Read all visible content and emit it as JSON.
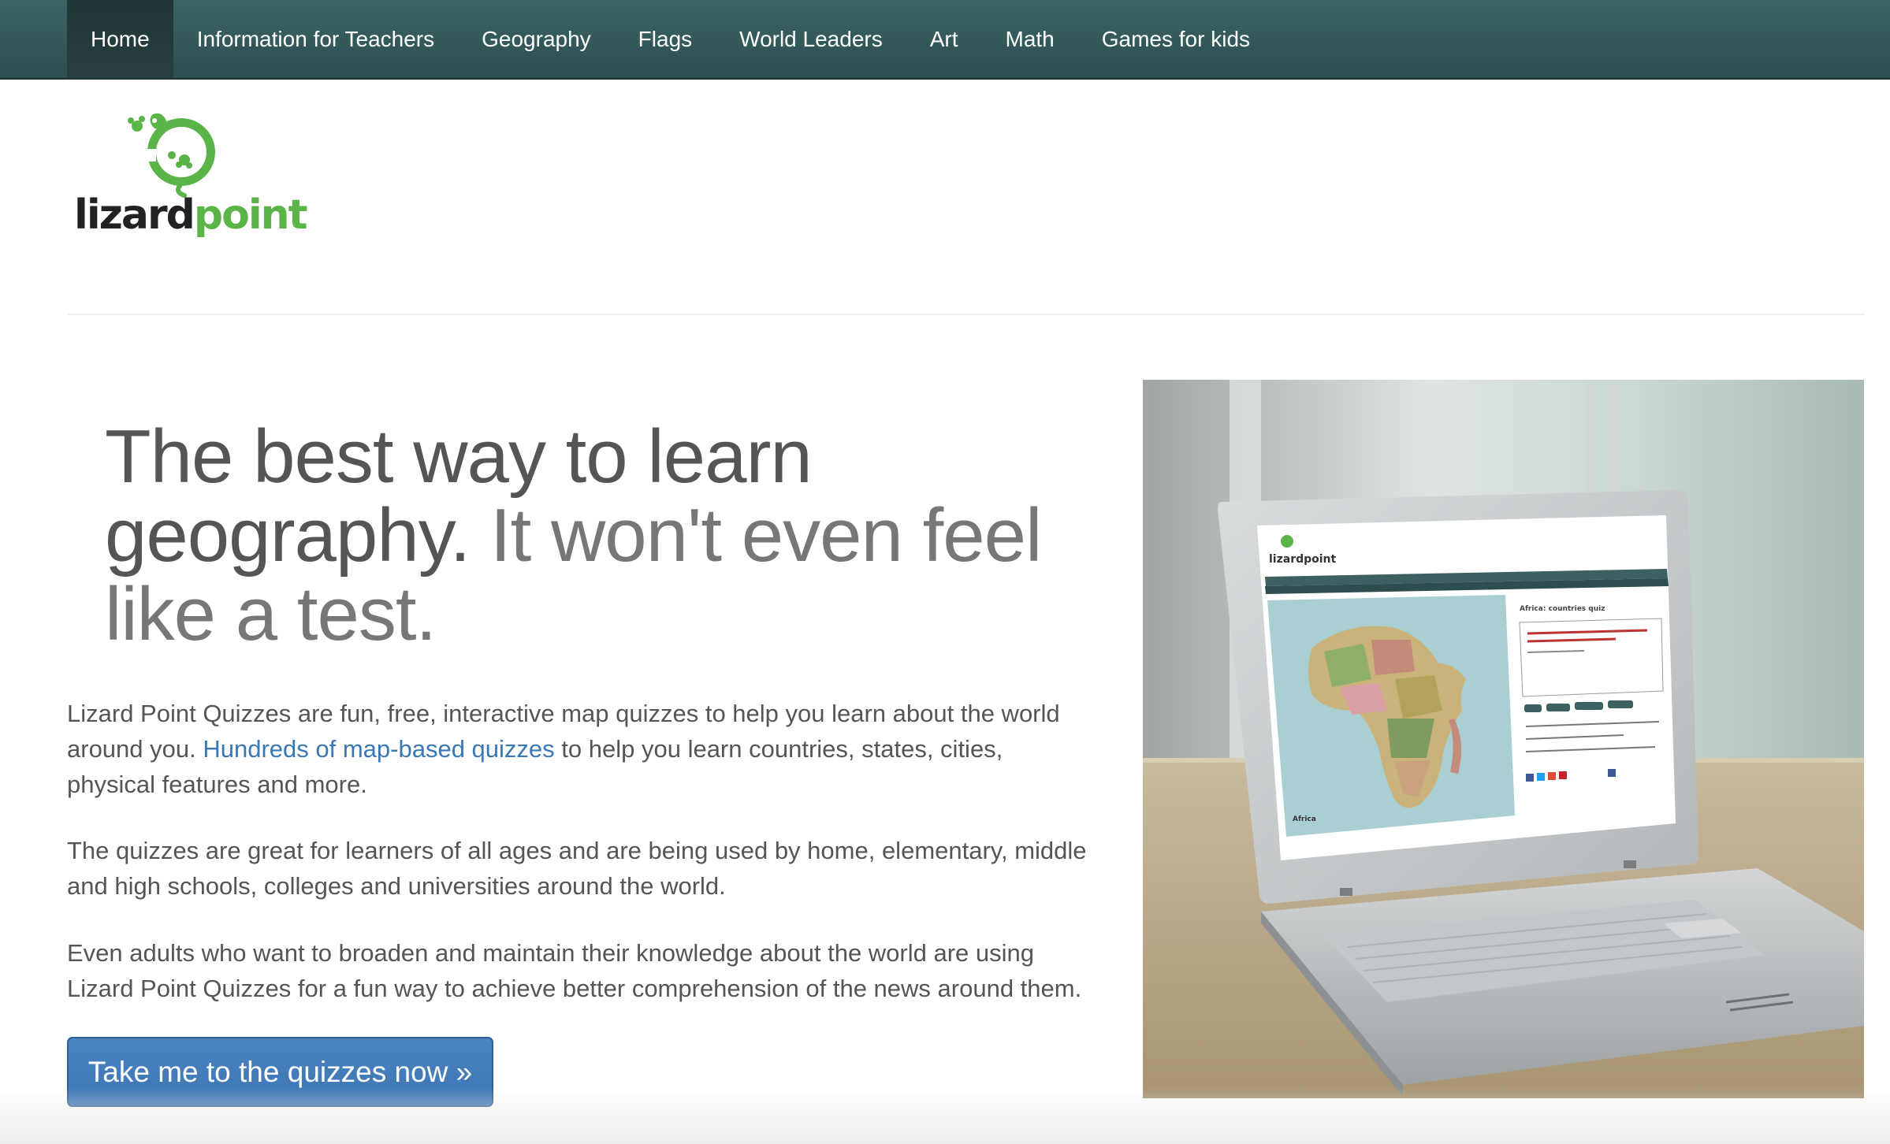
{
  "nav": {
    "items": [
      {
        "label": "Home",
        "active": true
      },
      {
        "label": "Information for Teachers"
      },
      {
        "label": "Geography"
      },
      {
        "label": "Flags"
      },
      {
        "label": "World Leaders"
      },
      {
        "label": "Art"
      },
      {
        "label": "Math"
      },
      {
        "label": "Games for kids"
      }
    ]
  },
  "logo": {
    "text_dark": "lizard",
    "text_green": "point",
    "icon": "lizard-icon"
  },
  "hero": {
    "headline_strong": "The best way to learn geography.",
    "headline_soft": " It won't even feel like a test.",
    "p1_before": "Lizard Point Quizzes are fun, free, interactive map quizzes to help you learn about the world around you. ",
    "p1_link": "Hundreds of map-based quizzes",
    "p1_after": " to help you learn countries, states, cities, physical features and more.",
    "p2": "The quizzes are great for learners of all ages and are being used by home, elementary, middle and high schools, colleges and universities around the world.",
    "p3": "Even adults who want to broaden and maintain their knowledge about the world are using Lizard Point Quizzes for a fun way to achieve better comprehension of the news around them.",
    "cta": "Take me to the quizzes now »"
  },
  "photo": {
    "screen_logo": "lizardpoint",
    "screen_title": "Africa: countries quiz",
    "map_caption": "Africa"
  },
  "colors": {
    "navbar": "#2f5354",
    "link": "#3a78b5",
    "button": "#4580bd",
    "logo_green": "#5ab448"
  }
}
